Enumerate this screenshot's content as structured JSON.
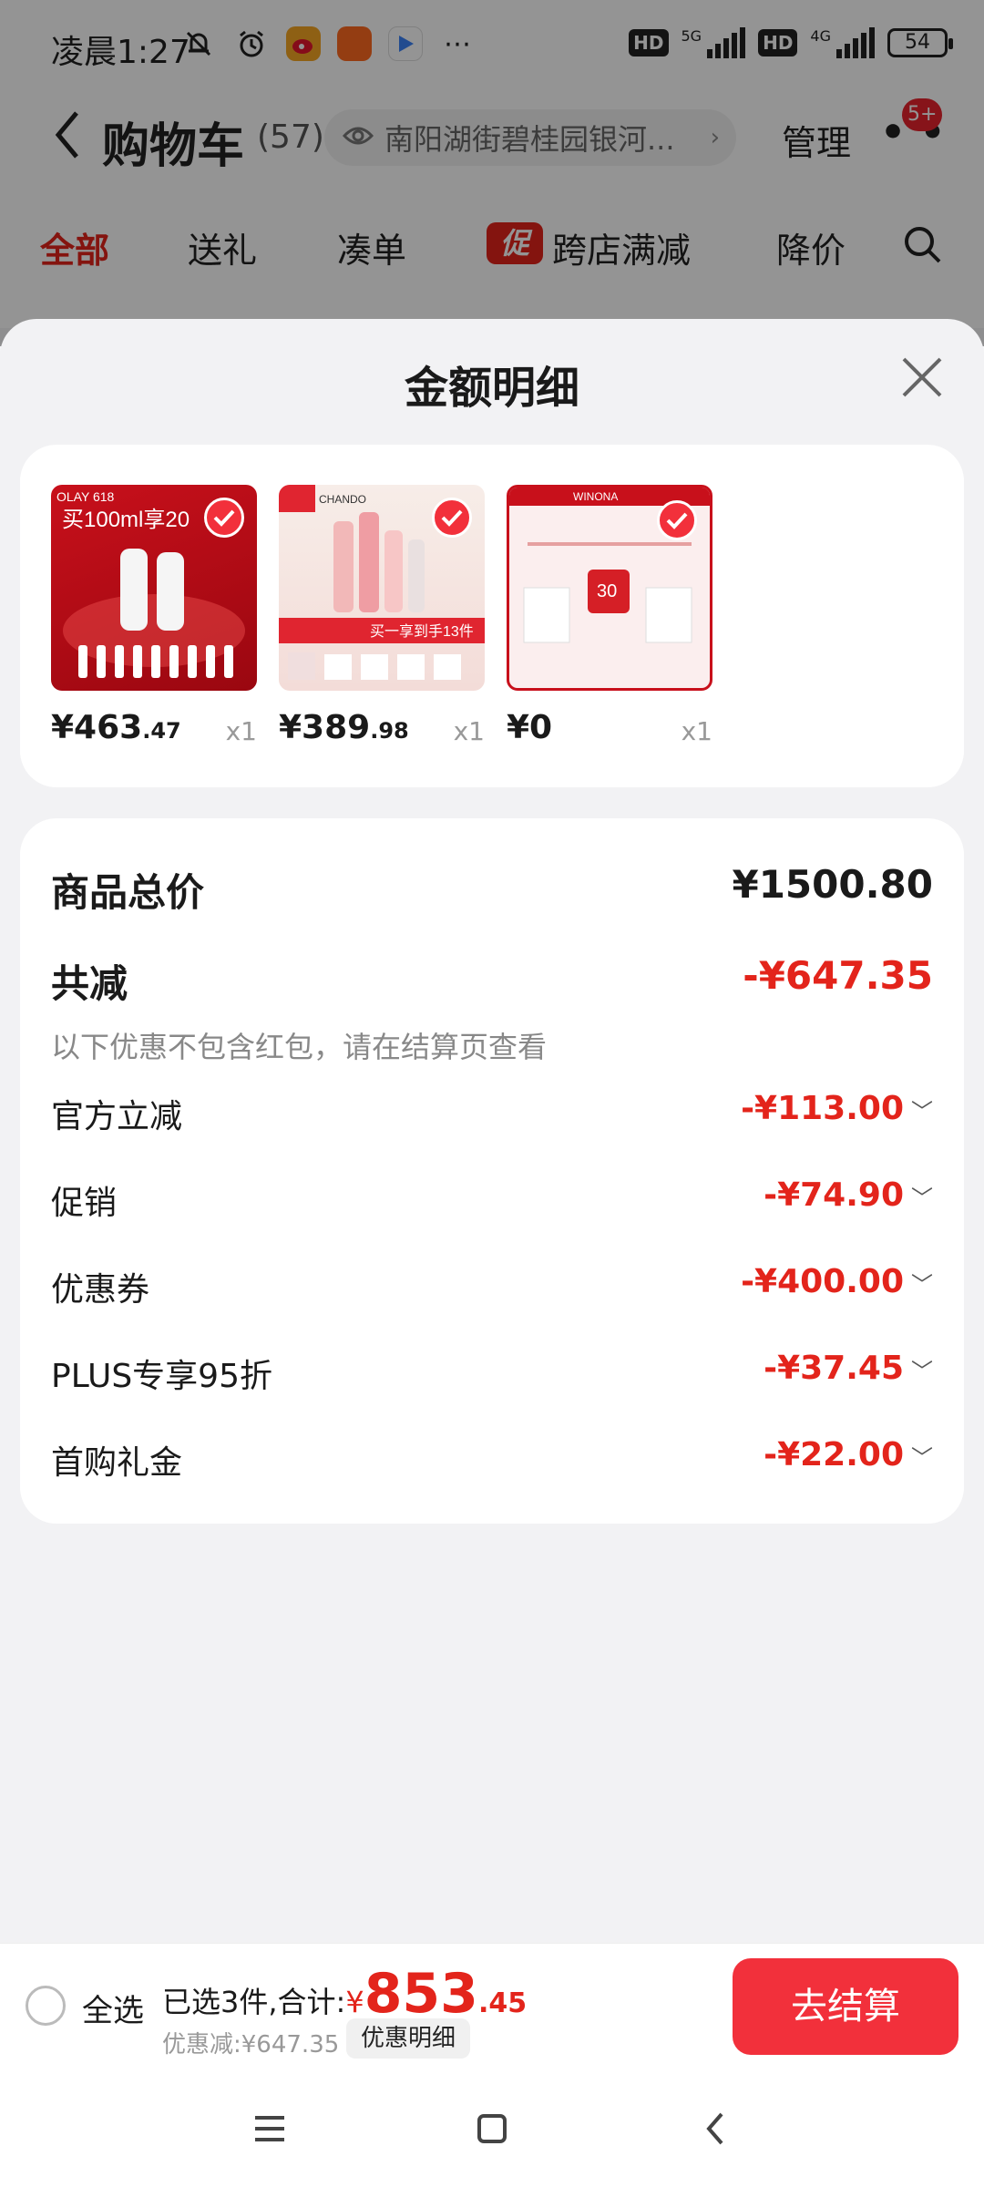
{
  "status_bar": {
    "time": "凌晨1:27",
    "network_1": "5G",
    "network_2": "4G",
    "hd_1": "HD",
    "hd_2": "HD",
    "battery": "54",
    "icons": [
      "mute-bell-icon",
      "alarm-icon",
      "weibo-app-icon",
      "shopping-app-icon",
      "video-app-icon",
      "more-dots-icon"
    ]
  },
  "cart_header": {
    "back_icon": "chevron-left-icon",
    "title": "购物车",
    "count": "(57)",
    "address": "南阳湖街碧桂园银河...",
    "manage_label": "管理",
    "more_icon": "more-dots-icon",
    "message_badge": "5+"
  },
  "tabs": [
    {
      "label": "全部",
      "active": true
    },
    {
      "label": "送礼",
      "active": false
    },
    {
      "label": "凑单",
      "active": false
    },
    {
      "label": "跨店满减",
      "tag": "促",
      "active": false
    },
    {
      "label": "降价",
      "active": false
    }
  ],
  "sheet": {
    "title": "金额明细",
    "close_icon": "close-icon",
    "products": [
      {
        "price_int": "¥463",
        "price_dec": ".47",
        "qty": "x1",
        "checked": true,
        "thumb_text": "买100ml享20",
        "brand": "OLAY 618"
      },
      {
        "price_int": "¥389",
        "price_dec": ".98",
        "qty": "x1",
        "checked": true,
        "thumb_text": "买一享到手13件",
        "brand": "CHANDO"
      },
      {
        "price_int": "¥0",
        "price_dec": "",
        "qty": "x1",
        "checked": true,
        "thumb_text": "30",
        "brand": "WINONA"
      }
    ],
    "total_label": "商品总价",
    "total_value": "¥1500.80",
    "reduce_label": "共减",
    "reduce_value": "-¥647.35",
    "note": "以下优惠不包含红包，请在结算页查看",
    "discounts": [
      {
        "label": "官方立减",
        "value": "-¥113.00"
      },
      {
        "label": "促销",
        "value": "-¥74.90"
      },
      {
        "label": "优惠券",
        "value": "-¥400.00"
      },
      {
        "label": "PLUS专享95折",
        "value": "-¥37.45"
      },
      {
        "label": "首购礼金",
        "value": "-¥22.00"
      }
    ]
  },
  "checkout": {
    "select_all": "全选",
    "selected_text": "已选3件,合计:",
    "yen": "¥",
    "total_int": "853",
    "total_dec": ".45",
    "discount_text": "优惠减:¥647.35",
    "detail_chip": "优惠明细",
    "button": "去结算"
  },
  "nav": {
    "menu_icon": "menu-icon",
    "home_icon": "home-square-icon",
    "back_icon": "back-chevron-icon"
  },
  "colors": {
    "accent_red": "#e3241b",
    "button_red": "#f2303b",
    "sheet_bg": "#f2f2f4"
  }
}
